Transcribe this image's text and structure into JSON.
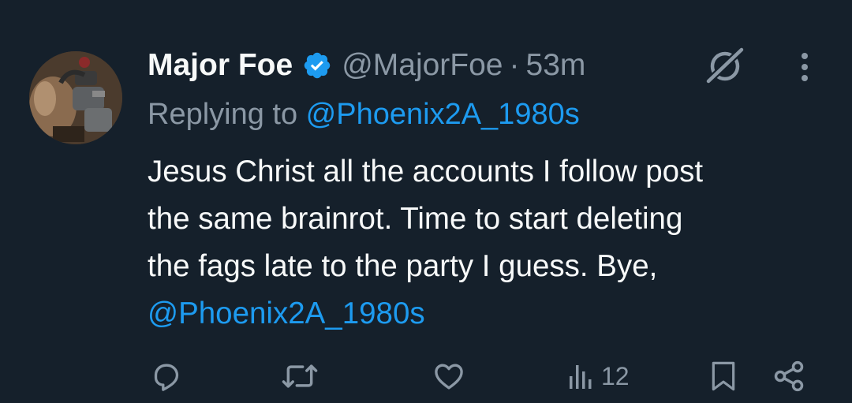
{
  "author": {
    "display_name": "Major Foe",
    "handle": "@MajorFoe",
    "separator": "·",
    "time": "53m",
    "verified": true
  },
  "reply": {
    "prefix": "Replying to ",
    "mention": "@Phoenix2A_1980s"
  },
  "body": {
    "line1": "Jesus Christ all the accounts I follow post",
    "line2": "the same brainrot. Time to start deleting",
    "line3": "the fags late to the party I guess. Bye,",
    "mention": "@Phoenix2A_1980s"
  },
  "actions": {
    "views_count": "12"
  },
  "colors": {
    "background": "#15202b",
    "text": "#f7f9f9",
    "muted": "#8b98a5",
    "accent": "#1d9bf0"
  },
  "icons": [
    "verified-badge-icon",
    "grok-icon",
    "more-icon",
    "reply-icon",
    "retweet-icon",
    "like-icon",
    "views-icon",
    "bookmark-icon",
    "share-icon"
  ]
}
